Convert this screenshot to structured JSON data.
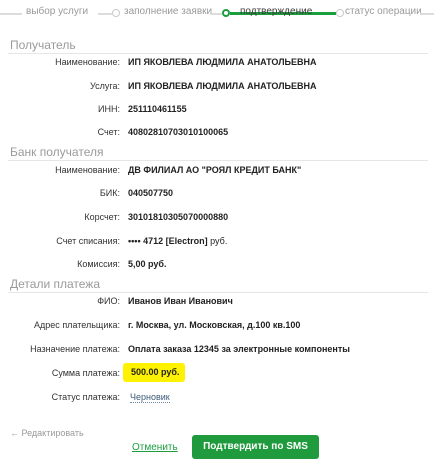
{
  "steps": [
    {
      "label": "выбор услуги",
      "state": "done"
    },
    {
      "label": "заполнение заявки",
      "state": "done"
    },
    {
      "label": "подтверждение",
      "state": "active"
    },
    {
      "label": "статус операции",
      "state": "pending"
    }
  ],
  "recipient": {
    "title": "Получатель",
    "name_label": "Наименование:",
    "name_value": "ИП ЯКОВЛЕВА ЛЮДМИЛА АНАТОЛЬЕВНА",
    "service_label": "Услуга:",
    "service_value": "ИП ЯКОВЛЕВА ЛЮДМИЛА АНАТОЛЬЕВНА",
    "inn_label": "ИНН:",
    "inn_value": "251110461155",
    "account_label": "Счет:",
    "account_value": "40802810703010100065"
  },
  "bank": {
    "title": "Банк получателя",
    "name_label": "Наименование:",
    "name_value": "ДВ ФИЛИАЛ АО \"РОЯЛ КРЕДИТ БАНК\"",
    "bik_label": "БИК:",
    "bik_value": "040507750",
    "corr_label": "Корсчет:",
    "corr_value": "30101810305070000880",
    "debit_label": "Счет списания:",
    "debit_value": "•••• 4712  [Electron]",
    "debit_unit": "руб.",
    "fee_label": "Комиссия:",
    "fee_value": "5,00 руб."
  },
  "payment": {
    "title": "Детали платежа",
    "fio_label": "ФИО:",
    "fio_value": "Иванов Иван Иванович",
    "address_label": "Адрес плательщика:",
    "address_value": "г. Москва, ул. Московская, д.100 кв.100",
    "purpose_label": "Назначение платежа:",
    "purpose_value": "Оплата заказа 12345 за электронные компоненты",
    "amount_label": "Сумма платежа:",
    "amount_value": "500.00 руб.",
    "status_label": "Статус платежа:",
    "status_value": "Черновик"
  },
  "footer": {
    "edit_label": "← Редактировать",
    "cancel_label": "Отменить",
    "confirm_label": "Подтвердить по SMS"
  },
  "colors": {
    "accent_green": "#1f9a3c",
    "highlight_yellow": "#fff200"
  }
}
